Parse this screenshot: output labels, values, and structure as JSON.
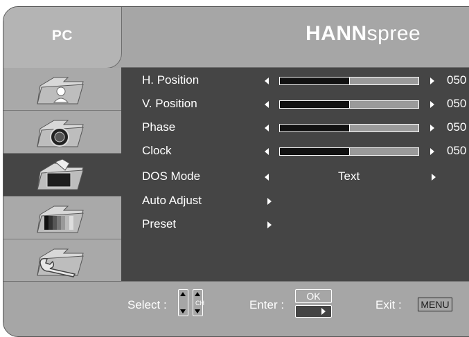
{
  "header": {
    "title": "PC",
    "brand_bold": "HANN",
    "brand_light": "spree"
  },
  "sidebar": {
    "items": [
      {
        "name": "picture",
        "icon": "folder-person-icon"
      },
      {
        "name": "audio",
        "icon": "folder-speaker-icon"
      },
      {
        "name": "pc",
        "icon": "folder-monitor-icon",
        "active": true
      },
      {
        "name": "color",
        "icon": "folder-color-bars-icon"
      },
      {
        "name": "setup",
        "icon": "folder-wrench-icon"
      }
    ]
  },
  "menu": {
    "rows": [
      {
        "label": "H. Position",
        "value": "050",
        "level": 0.5
      },
      {
        "label": "V. Position",
        "value": "050",
        "level": 0.5
      },
      {
        "label": "Phase",
        "value": "050",
        "level": 0.5
      },
      {
        "label": "Clock",
        "value": "050",
        "level": 0.5
      },
      {
        "label": "DOS Mode",
        "option": "Text"
      },
      {
        "label": "Auto Adjust"
      },
      {
        "label": "Preset"
      }
    ]
  },
  "footer": {
    "select_label": "Select :",
    "ch_label": "CH",
    "enter_label": "Enter :",
    "ok_label": "OK",
    "exit_label": "Exit :",
    "menu_label": "MENU"
  }
}
